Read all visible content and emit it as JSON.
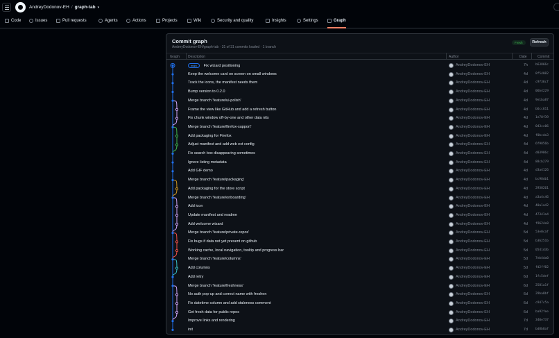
{
  "header": {
    "owner": "AndreyDodonov-EH",
    "separator": "/",
    "repo": "graph-tab",
    "caret": "▾"
  },
  "tabs": [
    {
      "label": "Code",
      "icon": "code-icon"
    },
    {
      "label": "Issues",
      "icon": "issue-icon"
    },
    {
      "label": "Pull requests",
      "icon": "pull-request-icon"
    },
    {
      "label": "Agents",
      "icon": "agent-icon"
    },
    {
      "label": "Actions",
      "icon": "play-icon"
    },
    {
      "label": "Projects",
      "icon": "table-icon"
    },
    {
      "label": "Wiki",
      "icon": "book-icon"
    },
    {
      "label": "Security and quality",
      "icon": "shield-icon"
    },
    {
      "label": "Insights",
      "icon": "graph-icon"
    },
    {
      "label": "Settings",
      "icon": "gear-icon"
    },
    {
      "label": "Graph",
      "icon": "git-branch-icon"
    }
  ],
  "panel": {
    "title": "Commit graph",
    "subtitle": "AndreyDodonov-EH/graph-tab · 31 of 31 commits loaded · 1 branch",
    "fresh_label": "Fresh",
    "refresh_label": "Refresh"
  },
  "columns": {
    "graph": "Graph",
    "description": "Description",
    "author": "Author",
    "date": "Date",
    "commit": "Commit"
  },
  "colors": {
    "main_line": "#1f6feb",
    "branch_magenta": "#d2a8ff",
    "branch_green": "#3fb950",
    "branch_yellow": "#d29922",
    "branch_red": "#f85149",
    "branch_cyan": "#39c5cf"
  },
  "commits": [
    {
      "badge": "main",
      "message": "Fix wizard positioning",
      "author": "AndreyDodonov-EH",
      "date": "7h",
      "hash": "b63866c"
    },
    {
      "badge": "",
      "message": "Keep the welcome card on screen on small windows",
      "author": "AndreyDodonov-EH",
      "date": "4d",
      "hash": "8f54082"
    },
    {
      "badge": "",
      "message": "Track the icons, the manifest needs them",
      "author": "AndreyDodonov-EH",
      "date": "4d",
      "hash": "c9736cf"
    },
    {
      "badge": "",
      "message": "Bump version to 0.2.0",
      "author": "AndreyDodonov-EH",
      "date": "4d",
      "hash": "06b4229"
    },
    {
      "badge": "",
      "message": "Merge branch 'feature/ui-polish'",
      "author": "AndreyDodonov-EH",
      "date": "4d",
      "hash": "9e1ba87"
    },
    {
      "badge": "",
      "message": "Frame the view like GitHub and add a refresh button",
      "author": "AndreyDodonov-EH",
      "date": "4d",
      "hash": "b6cc611"
    },
    {
      "badge": "",
      "message": "Fix chunk window off-by-one and other data nits",
      "author": "AndreyDodonov-EH",
      "date": "4d",
      "hash": "1e78f39"
    },
    {
      "badge": "",
      "message": "Merge branch 'feature/firefox-support'",
      "author": "AndreyDodonov-EH",
      "date": "4d",
      "hash": "043cc06"
    },
    {
      "badge": "",
      "message": "Add packaging for Firefox",
      "author": "AndreyDodonov-EH",
      "date": "4d",
      "hash": "f0bcda3"
    },
    {
      "badge": "",
      "message": "Adjust manifest and add web ext config",
      "author": "AndreyDodonov-EH",
      "date": "4d",
      "hash": "6f9856b"
    },
    {
      "badge": "",
      "message": "Fix search box disappearing sometimes",
      "author": "AndreyDodonov-EH",
      "date": "4d",
      "hash": "d03986c"
    },
    {
      "badge": "",
      "message": "Ignore listing metadata",
      "author": "AndreyDodonov-EH",
      "date": "4d",
      "hash": "88cb279"
    },
    {
      "badge": "",
      "message": "Add GIF demo",
      "author": "AndreyDodonov-EH",
      "date": "4d",
      "hash": "d3a4126"
    },
    {
      "badge": "",
      "message": "Merge branch 'feature/packaging'",
      "author": "AndreyDodonov-EH",
      "date": "4d",
      "hash": "bc98db1"
    },
    {
      "badge": "",
      "message": "Add packaging for the store script",
      "author": "AndreyDodonov-EH",
      "date": "4d",
      "hash": "2938261"
    },
    {
      "badge": "",
      "message": "Merge branch 'feature/onboarding'",
      "author": "AndreyDodonov-EH",
      "date": "4d",
      "hash": "a3a4c46"
    },
    {
      "badge": "",
      "message": "Add icon",
      "author": "AndreyDodonov-EH",
      "date": "4d",
      "hash": "40a1a42"
    },
    {
      "badge": "",
      "message": "Update manifest and readme",
      "author": "AndreyDodonov-EH",
      "date": "4d",
      "hash": "47341a4"
    },
    {
      "badge": "",
      "message": "Add welcome wizard",
      "author": "AndreyDodonov-EH",
      "date": "4d",
      "hash": "f9624e8"
    },
    {
      "badge": "",
      "message": "Merge branch 'feature/private-repos'",
      "author": "AndreyDodonov-EH",
      "date": "5d",
      "hash": "53e0caf"
    },
    {
      "badge": "",
      "message": "Fix bugs if data not yet present on github",
      "author": "AndreyDodonov-EH",
      "date": "5d",
      "hash": "b36251b"
    },
    {
      "badge": "",
      "message": "Working cache, local navigation, tooltip and progress bar",
      "author": "AndreyDodonov-EH",
      "date": "5d",
      "hash": "0541d3b"
    },
    {
      "badge": "",
      "message": "Merge branch 'feature/columns'",
      "author": "AndreyDodonov-EH",
      "date": "5d",
      "hash": "7eb4da0"
    },
    {
      "badge": "",
      "message": "Add columns",
      "author": "AndreyDodonov-EH",
      "date": "5d",
      "hash": "fd2ff02"
    },
    {
      "badge": "",
      "message": "Add retry",
      "author": "AndreyDodonov-EH",
      "date": "6d",
      "hash": "1fc5def"
    },
    {
      "badge": "",
      "message": "Merge branch 'feature/freshness'",
      "author": "AndreyDodonov-EH",
      "date": "6d",
      "hash": "2581a1f"
    },
    {
      "badge": "",
      "message": "No auth pop-up and correct name with freshen",
      "author": "AndreyDodonov-EH",
      "date": "6d",
      "hash": "29ba8bf"
    },
    {
      "badge": "",
      "message": "Fix datetime column and add staleness comment",
      "author": "AndreyDodonov-EH",
      "date": "6d",
      "hash": "c947c5a"
    },
    {
      "badge": "",
      "message": "Get fresh data for public repos",
      "author": "AndreyDodonov-EH",
      "date": "6d",
      "hash": "ba92fee"
    },
    {
      "badge": "",
      "message": "Improve links and rendering",
      "author": "AndreyDodonov-EH",
      "date": "7d",
      "hash": "340e737"
    },
    {
      "badge": "",
      "message": "init",
      "author": "AndreyDodonov-EH",
      "date": "7d",
      "hash": "bd8b8af"
    }
  ]
}
